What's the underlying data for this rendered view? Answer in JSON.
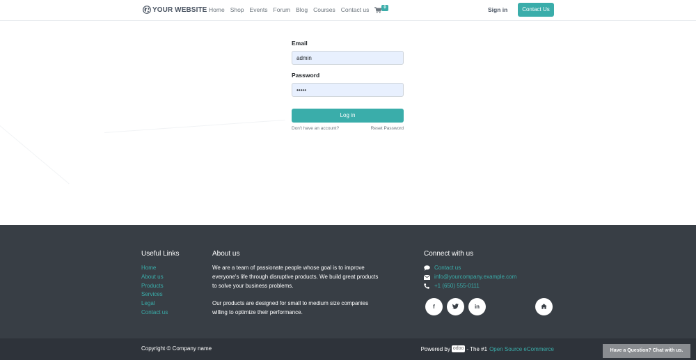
{
  "header": {
    "logo_text": "YOUR WEBSITE",
    "logo_icon": "globe-icon",
    "nav": [
      "Home",
      "Shop",
      "Events",
      "Forum",
      "Blog",
      "Courses",
      "Contact us"
    ],
    "cart_count": "0",
    "cart_icon": "cart-icon",
    "signin": "Sign in",
    "contact_button": "Contact Us"
  },
  "login": {
    "email_label": "Email",
    "email_value": "admin",
    "password_label": "Password",
    "password_value": "admin",
    "login_button": "Log in",
    "signup_link": "Don't have an account?",
    "reset_link": "Reset Password"
  },
  "footer": {
    "useful_links_title": "Useful Links",
    "useful_links": [
      "Home",
      "About us",
      "Products",
      "Services",
      "Legal",
      "Contact us"
    ],
    "about_title": "About us",
    "about_p1": "We are a team of passionate people whose goal is to improve everyone's life through disruptive products. We build great products to solve your business problems.",
    "about_p2": "Our products are designed for small to medium size companies willing to optimize their performance.",
    "connect_title": "Connect with us",
    "connect": {
      "contact": "Contact us",
      "email": "info@yourcompany.example.com",
      "phone": "+1 (650) 555-0111"
    },
    "social": {
      "facebook": "f",
      "twitter_icon": "twitter-icon",
      "linkedin": "in",
      "home_icon": "home-icon"
    },
    "copyright": "Copyright © Company name",
    "powered_prefix": "Powered by",
    "powered_brand": "odoo",
    "powered_mid": "- The #1",
    "powered_link": "Open Source eCommerce"
  },
  "chat": {
    "label": "Have a Question? Chat with us."
  },
  "colors": {
    "accent": "#3aadaa",
    "footer_bg": "#383e45",
    "copybar_bg": "#2e333a",
    "input_bg": "#e8f0fe"
  }
}
